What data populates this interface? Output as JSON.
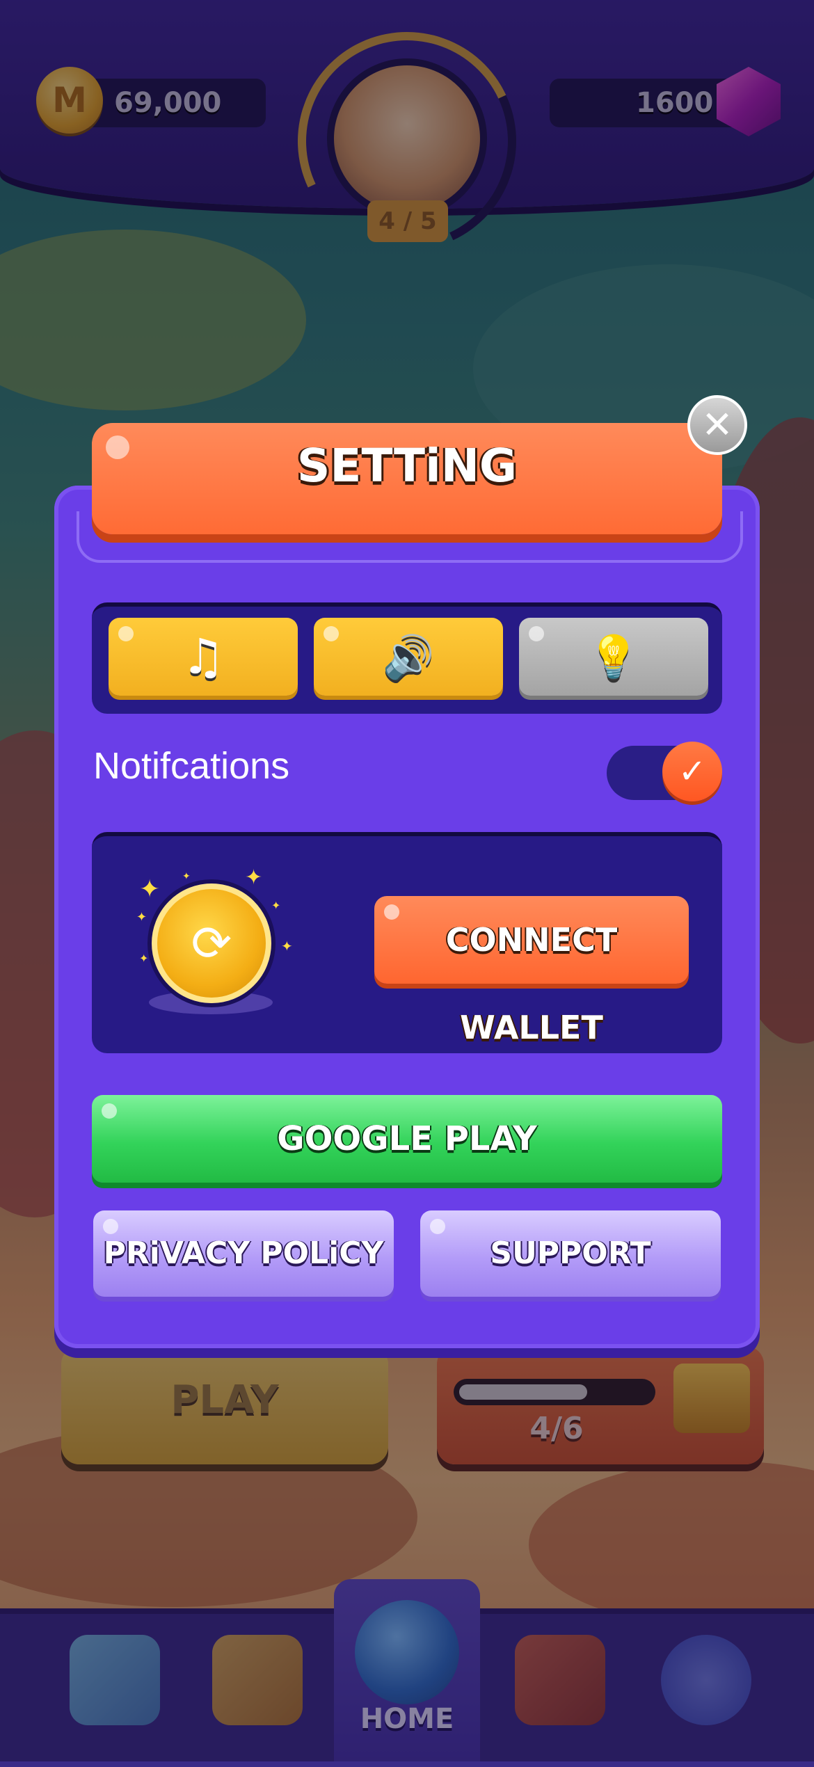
{
  "hud": {
    "coins": "69,000",
    "gems": "1600",
    "level": "4 / 5"
  },
  "background": {
    "play_label": "PLAY",
    "chest_progress": "4/6",
    "chest_fill": 0.67
  },
  "nav": {
    "home_label": "HOME",
    "items": [
      "map-icon",
      "trophy-icon",
      "home-globe-icon",
      "backpack-icon",
      "settings-gear-icon"
    ]
  },
  "modal": {
    "title": "SETTiNG",
    "close_glyph": "✕",
    "toggles": [
      {
        "name": "music",
        "icon": "music-note-icon",
        "glyph": "♫",
        "state": "on"
      },
      {
        "name": "sound",
        "icon": "speaker-icon",
        "glyph": "🔊",
        "state": "on"
      },
      {
        "name": "hint",
        "icon": "lightbulb-icon",
        "glyph": "💡",
        "state": "off"
      }
    ],
    "notifications_label": "Notifcations",
    "notifications_on": true,
    "notifications_check": "✓",
    "wallet_coin_glyph": "⟳",
    "connect_wallet_label": "CONNECT WALLET",
    "google_play_label": "GOOGLE PLAY",
    "privacy_policy_label": "PRiVACY POLiCY",
    "support_label": "SUPPORT"
  },
  "colors": {
    "modal_purple": "#6a3ee8",
    "title_orange": "#ff6b35",
    "panel_navy": "#271a86",
    "google_green": "#33d35a",
    "toggle_yellow": "#f2b020",
    "secondary_lavender": "#b39cf8"
  }
}
